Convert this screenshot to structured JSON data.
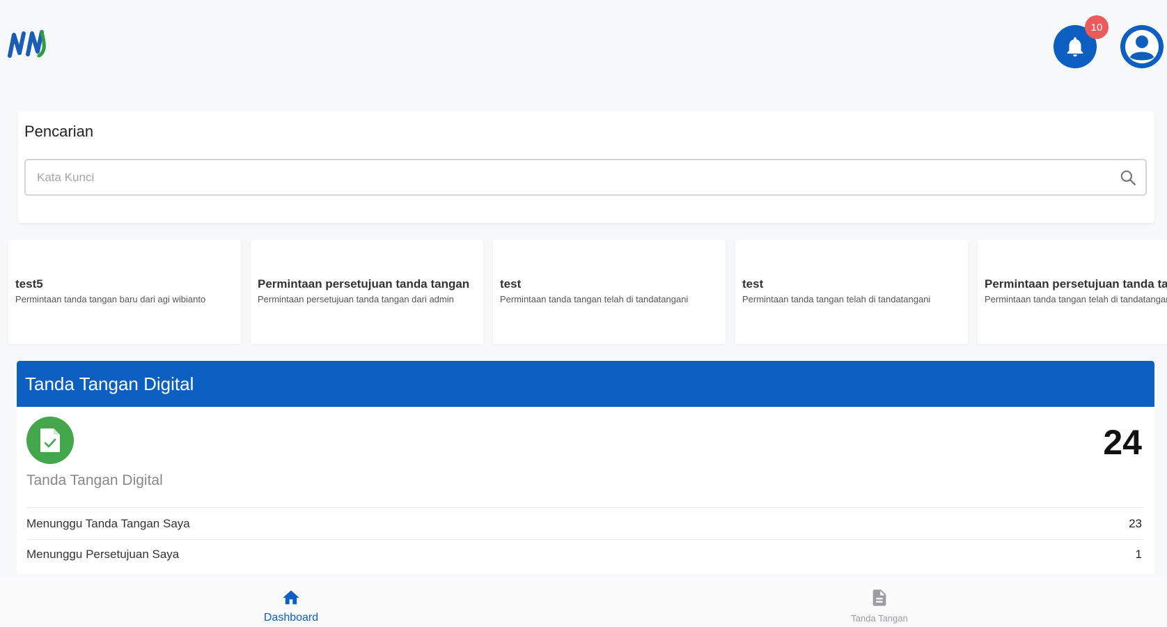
{
  "header": {
    "notification_count": "10",
    "colors": {
      "primary": "#0c5fc0",
      "badge": "#ec5a5c",
      "logo_green": "#2e9c45"
    }
  },
  "search": {
    "title": "Pencarian",
    "placeholder": "Kata Kunci",
    "value": ""
  },
  "notifications": [
    {
      "title": "test5",
      "description": "Permintaan tanda tangan baru dari agi wibianto"
    },
    {
      "title": "Permintaan persetujuan tanda tangan",
      "description": "Permintaan persetujuan tanda tangan dari admin"
    },
    {
      "title": "test",
      "description": "Permintaan tanda tangan telah di tandatangani"
    },
    {
      "title": "test",
      "description": "Permintaan tanda tangan telah di tandatangani"
    },
    {
      "title": "Permintaan persetujuan tanda tangan",
      "description": "Permintaan tanda tangan telah di tandatangani"
    }
  ],
  "signature_card": {
    "header_title": "Tanda Tangan Digital",
    "label": "Tanda Tangan Digital",
    "total": "24",
    "rows": [
      {
        "label": "Menunggu Tanda Tangan Saya",
        "value": "23"
      },
      {
        "label": "Menunggu Persetujuan Saya",
        "value": "1"
      }
    ],
    "icon_color": "#43a64a"
  },
  "bottom_nav": {
    "items": [
      {
        "label": "Dashboard",
        "icon": "home-icon",
        "active": true
      },
      {
        "label": "Tanda Tangan",
        "icon": "document-icon",
        "active": false
      }
    ]
  }
}
